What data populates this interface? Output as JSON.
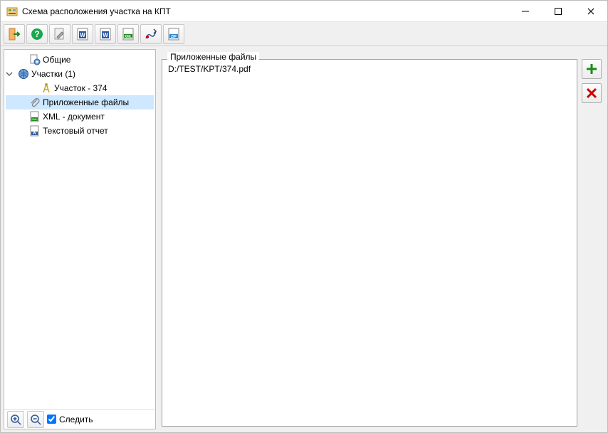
{
  "window": {
    "title": "Схема расположения участка на КПТ"
  },
  "toolbar": {
    "buttons": [
      {
        "name": "exit-button",
        "icon": "exit"
      },
      {
        "name": "help-button",
        "icon": "help"
      },
      {
        "name": "edit-button",
        "icon": "edit"
      },
      {
        "name": "word-button",
        "icon": "word"
      },
      {
        "name": "word-alt-button",
        "icon": "word2"
      },
      {
        "name": "xml-button",
        "icon": "xml"
      },
      {
        "name": "map-button",
        "icon": "map"
      },
      {
        "name": "zip-button",
        "icon": "zip"
      }
    ]
  },
  "tree": {
    "items": [
      {
        "name": "tree-general",
        "indent": 1,
        "icon": "doc-gear",
        "label": "Общие",
        "expand": null,
        "selected": false
      },
      {
        "name": "tree-parcels",
        "indent": 0,
        "icon": "globe",
        "label": "Участки (1)",
        "expand": "open",
        "selected": false
      },
      {
        "name": "tree-parcel-374",
        "indent": 2,
        "icon": "surveyor",
        "label": "Участок - 374",
        "expand": null,
        "selected": false
      },
      {
        "name": "tree-attached-files",
        "indent": 1,
        "icon": "attachment",
        "label": "Приложенные файлы",
        "expand": null,
        "selected": true
      },
      {
        "name": "tree-xml-doc",
        "indent": 1,
        "icon": "xml-doc",
        "label": "XML - документ",
        "expand": null,
        "selected": false
      },
      {
        "name": "tree-text-report",
        "indent": 1,
        "icon": "text-doc",
        "label": "Текстовый отчет",
        "expand": null,
        "selected": false
      }
    ]
  },
  "left_bottom": {
    "follow_label": "Следить",
    "follow_checked": true
  },
  "main": {
    "group_label": "Приложенные файлы",
    "files": [
      {
        "path": "D:/TEST/KPT/374.pdf"
      }
    ]
  }
}
